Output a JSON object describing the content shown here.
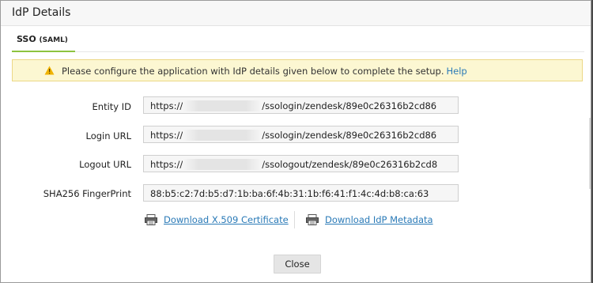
{
  "dialog": {
    "title": "IdP Details"
  },
  "tabs": [
    {
      "label": "SSO",
      "sub_label": "(SAML)"
    }
  ],
  "alert": {
    "message": "Please configure the application with IdP details given below to complete the setup.",
    "link_label": "Help",
    "icon": "warning-icon"
  },
  "fields": {
    "entity_id": {
      "label": "Entity ID",
      "prefix": "https://",
      "suffix": "/ssologin/zendesk/89e0c26316b2cd86"
    },
    "login_url": {
      "label": "Login URL",
      "prefix": "https://",
      "suffix": "/ssologin/zendesk/89e0c26316b2cd86"
    },
    "logout_url": {
      "label": "Logout URL",
      "prefix": "https://",
      "suffix": "/ssologout/zendesk/89e0c26316b2cd8"
    },
    "fingerprint": {
      "label": "SHA256 FingerPrint",
      "value": "88:b5:c2:7d:b5:d7:1b:ba:6f:4b:31:1b:f6:41:f1:4c:4d:b8:ca:63"
    }
  },
  "downloads": {
    "certificate_label": "Download X.509 Certificate",
    "metadata_label": "Download IdP Metadata",
    "icon": "printer-download-icon"
  },
  "buttons": {
    "close_label": "Close"
  },
  "colors": {
    "accent": "#8dc33f",
    "link": "#2a7ab7",
    "alert_bg": "#fcf7d2"
  }
}
